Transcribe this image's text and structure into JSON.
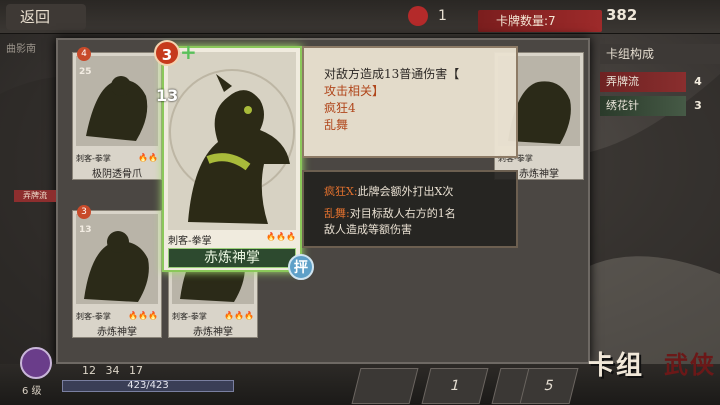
{
  "topbar": {
    "back_label": "返回",
    "gen_value": "1",
    "card_count_label": "卡牌数量:7",
    "gold": "382"
  },
  "background_label": "曲影南",
  "grid_cards": [
    {
      "cost": "4",
      "attack": "25",
      "type": "刺客-拳掌",
      "name": "极阴透骨爪",
      "flames": "🔥🔥"
    },
    {
      "cost": "3",
      "attack": "13",
      "type": "刺客-拳掌",
      "name": "赤炼神掌",
      "flames": "🔥🔥🔥"
    },
    {
      "cost": "3",
      "attack": "13",
      "type": "刺客-拳掌",
      "name": "赤炼神掌",
      "flames": "🔥🔥🔥"
    }
  ],
  "right_card": {
    "type": "刺客-拳掌",
    "name": "赤炼神掌"
  },
  "tag_label": "弄牌流",
  "big_card": {
    "cost": "3",
    "plus": "+",
    "attack": "13",
    "type": "刺客-拳掌",
    "flames": "🔥🔥🔥",
    "name": "赤炼神掌",
    "upgrade": "抨"
  },
  "description": {
    "line1": "对敌方造成13普通伤害【",
    "line2": "攻击相关】",
    "line3": "疯狂4",
    "line4": "乱舞"
  },
  "keywords": {
    "k1_name": "疯狂X:",
    "k1_text": "此牌会额外打出X次",
    "k2_name": "乱舞:",
    "k2_text": "对目标敌人右方的1名",
    "k2_text2": "敌人造成等额伤害"
  },
  "deck_panel": {
    "title": "卡组构成",
    "rows": [
      {
        "label": "弄牌流",
        "count": "4"
      },
      {
        "label": "绣花针",
        "count": "3"
      }
    ]
  },
  "player": {
    "level": "6 级",
    "stats": "12 34 17",
    "hp": "423/423"
  },
  "slots": [
    "",
    "1",
    "",
    "5"
  ],
  "deck_button": {
    "label": "卡组",
    "label2": "武侠"
  }
}
